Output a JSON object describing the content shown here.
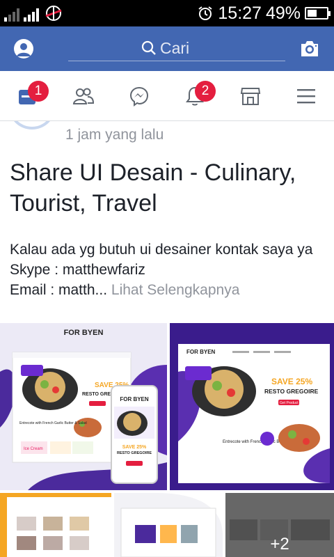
{
  "status_bar": {
    "time": "15:27",
    "battery": "49%",
    "battery_level": 0.49
  },
  "app_bar": {
    "search_placeholder": "Cari",
    "profile_icon": "profile-icon",
    "camera_icon": "camera-icon"
  },
  "tabs": [
    {
      "name": "news-feed",
      "icon": "feed-icon",
      "badge": "1"
    },
    {
      "name": "friends",
      "icon": "friends-icon",
      "badge": ""
    },
    {
      "name": "messenger",
      "icon": "messenger-icon",
      "badge": ""
    },
    {
      "name": "notifications",
      "icon": "bell-icon",
      "badge": "2"
    },
    {
      "name": "marketplace",
      "icon": "store-icon",
      "badge": ""
    },
    {
      "name": "menu",
      "icon": "hamburger-icon",
      "badge": ""
    }
  ],
  "post": {
    "timestamp": "1 jam yang lalu",
    "title": "Share UI Desain - Culinary, Tourist, Travel",
    "body_line1": "Kalau ada yg butuh ui desainer kontak saya ya",
    "body_line2": "Skype : matthewfariz",
    "body_line3": "Email : matth...",
    "see_more": "Lihat Selengkapnya",
    "more_photos": "+2",
    "photo1": {
      "logo": "FOR BYEN",
      "offer": "SAVE 25%",
      "headline": "RESTO GREGOIRE",
      "cta": "Get Product",
      "promo": "Entrecote with French Garlic Butter & Salad",
      "sticker": "Ice Cream"
    },
    "photo2": {
      "logo": "FOR BYEN",
      "offer": "SAVE 25%",
      "headline": "RESTO GREGOIRE",
      "cta": "Get Product",
      "promo": "Entrecote with French Garlic Butter & Salad"
    }
  },
  "colors": {
    "facebook_blue": "#4267b2",
    "badge_red": "#e41e3f",
    "muted_text": "#90949c"
  }
}
